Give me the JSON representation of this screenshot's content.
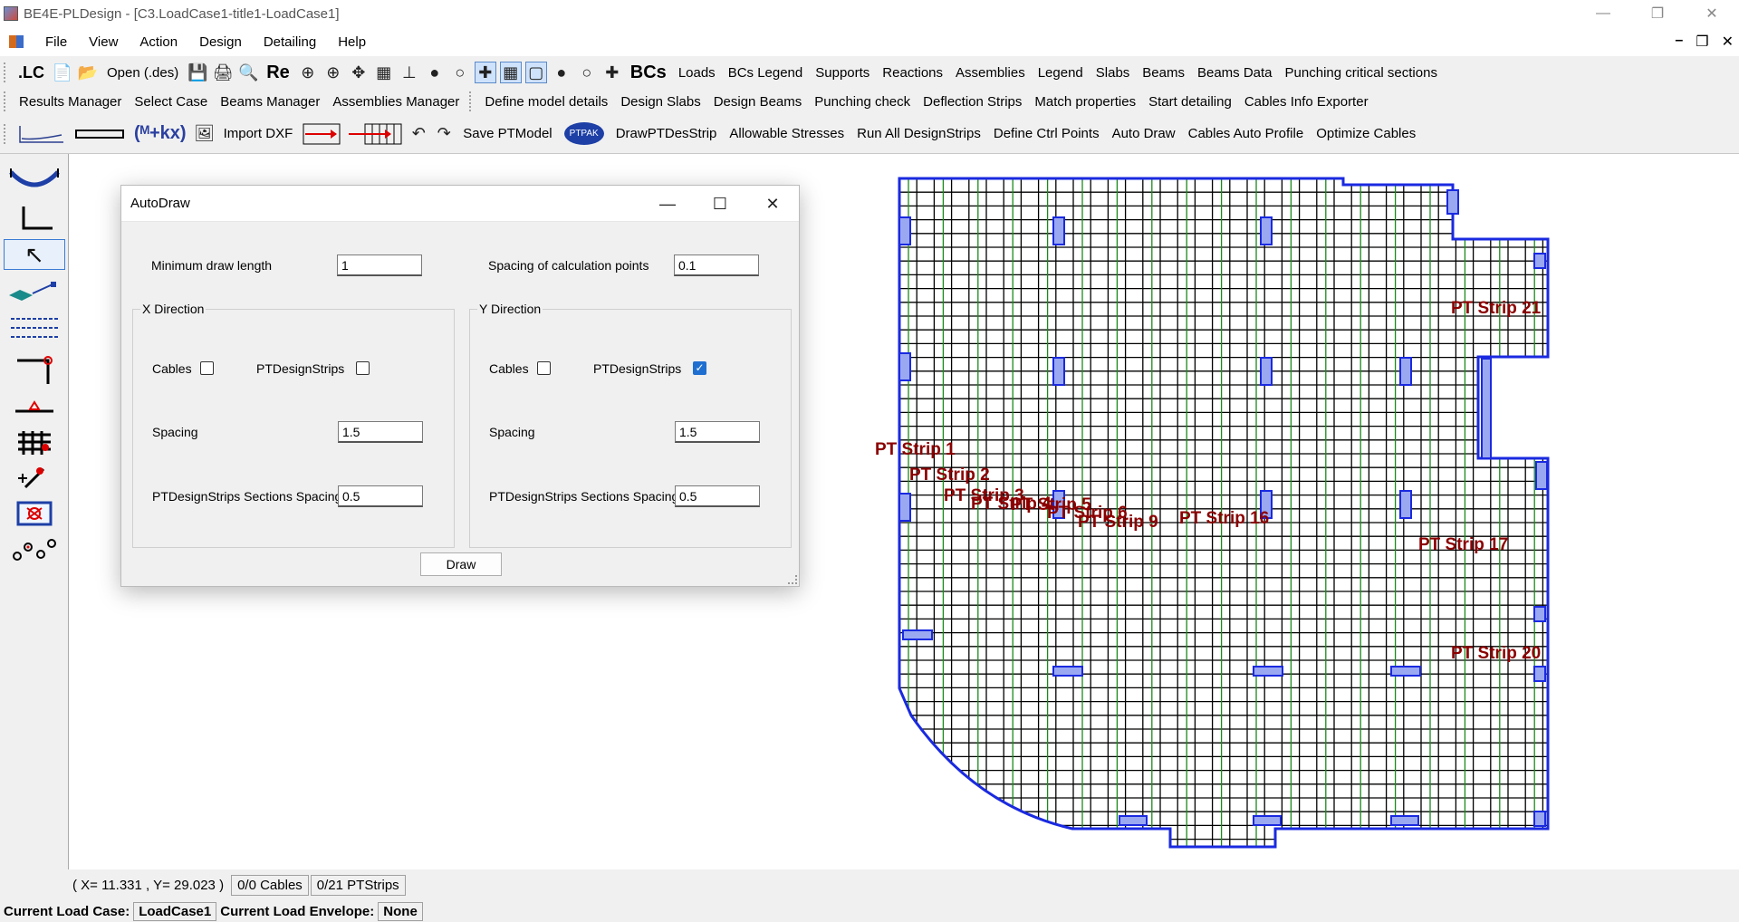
{
  "window": {
    "title": "BE4E-PLDesign - [C3.LoadCase1-title1-LoadCase1]"
  },
  "menu": {
    "items": [
      "File",
      "View",
      "Action",
      "Design",
      "Detailing",
      "Help"
    ]
  },
  "toolbar1": {
    "lc_label": ".LC",
    "open_label": "Open (.des)",
    "re_label": "Re",
    "bcs_label": "BCs",
    "links": [
      "Loads",
      "BCs Legend",
      "Supports",
      "Reactions",
      "Assemblies",
      "Legend",
      "Slabs",
      "Beams",
      "Beams Data",
      "Punching critical sections"
    ]
  },
  "toolbar2": {
    "links_a": [
      "Results Manager",
      "Select Case",
      "Beams Manager",
      "Assemblies Manager"
    ],
    "links_b": [
      "Define model details",
      "Design Slabs",
      "Design Beams",
      "Punching check",
      "Deflection Strips",
      "Match properties",
      "Start detailing",
      "Cables Info Exporter"
    ]
  },
  "toolbar3": {
    "formula_label": "(ᴹ+kx)",
    "import_dxf": "Import DXF",
    "save_ptmodel": "Save PTModel",
    "ptpak": "PTPAK",
    "links": [
      "DrawPTDesStrip",
      "Allowable Stresses",
      "Run All DesignStrips",
      "Define Ctrl Points",
      "Auto Draw",
      "Cables Auto Profile",
      "Optimize Cables"
    ]
  },
  "canvas": {
    "strip_labels": [
      {
        "text": "PT Strip 1",
        "type": "strip"
      },
      {
        "text": "PT Strip 2",
        "type": "strip"
      },
      {
        "text": "PT Strip 3",
        "type": "strip"
      },
      {
        "text": "PT Strip 4",
        "type": "strip"
      },
      {
        "text": "PT Strip 5",
        "type": "strip"
      },
      {
        "text": "PT Strip 6",
        "type": "strip"
      },
      {
        "text": "PT Strip 9",
        "type": "strip"
      },
      {
        "text": "PT Strip 16",
        "type": "strip"
      },
      {
        "text": "PT Strip 17",
        "type": "strip"
      },
      {
        "text": "PT Strip 21",
        "type": "strip"
      },
      {
        "text": "PT Strip 20",
        "type": "strip"
      }
    ]
  },
  "status": {
    "coords": "( X= 11.331 , Y= 29.023 )",
    "cables": "0/0 Cables",
    "ptstrips": "0/21 PTStrips",
    "load_case_label": "Current Load Case:",
    "load_case_value": "LoadCase1",
    "load_envelope_label": "Current Load Envelope:",
    "load_envelope_value": "None"
  },
  "dialog": {
    "title": "AutoDraw",
    "min_draw_length_label": "Minimum draw length",
    "min_draw_length_value": "1",
    "spacing_calc_label": "Spacing of calculation points",
    "spacing_calc_value": "0.1",
    "x_dir": {
      "title": "X Direction",
      "cables_label": "Cables",
      "cables_checked": false,
      "ptstrips_label": "PTDesignStrips",
      "ptstrips_checked": false,
      "spacing_label": "Spacing",
      "spacing_value": "1.5",
      "sections_label": "PTDesignStrips Sections Spacing",
      "sections_value": "0.5"
    },
    "y_dir": {
      "title": "Y Direction",
      "cables_label": "Cables",
      "cables_checked": false,
      "ptstrips_label": "PTDesignStrips",
      "ptstrips_checked": true,
      "spacing_label": "Spacing",
      "spacing_value": "1.5",
      "sections_label": "PTDesignStrips Sections Spacing",
      "sections_value": "0.5"
    },
    "draw_label": "Draw"
  },
  "colors": {
    "slab_outline": "#1a2ae0",
    "mesh": "#000000",
    "strip_lines": "#1a8a1a",
    "labels": "#8b0000",
    "column_fill": "#9aa8f2"
  }
}
